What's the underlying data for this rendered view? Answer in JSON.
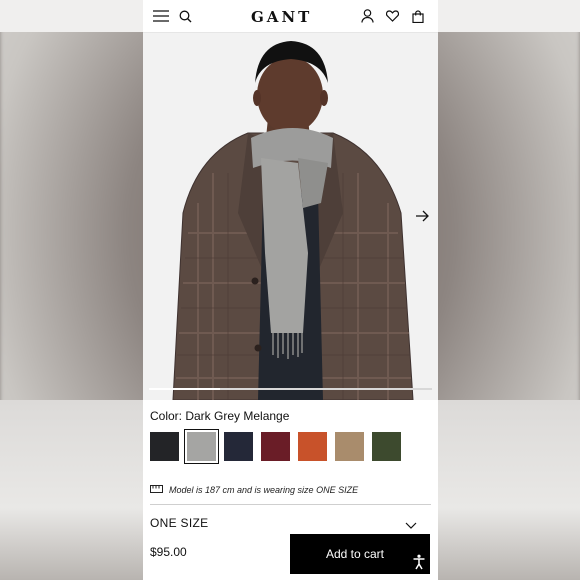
{
  "header": {
    "brand": "GANT",
    "icons": [
      "menu-icon",
      "search-icon",
      "account-icon",
      "wishlist-icon",
      "bag-icon"
    ]
  },
  "gallery": {
    "next_icon": "arrow-right-icon",
    "progress": 0.25
  },
  "product": {
    "color_label": "Color: Dark Grey Melange",
    "swatches": [
      {
        "name": "black",
        "hex": "#232427",
        "selected": false
      },
      {
        "name": "dark-grey-melange",
        "hex": "#a5a5a3",
        "selected": true
      },
      {
        "name": "navy",
        "hex": "#242838",
        "selected": false
      },
      {
        "name": "burgundy",
        "hex": "#6a1d27",
        "selected": false
      },
      {
        "name": "orange",
        "hex": "#c8522a",
        "selected": false
      },
      {
        "name": "camel",
        "hex": "#a98c6c",
        "selected": false
      },
      {
        "name": "olive",
        "hex": "#3d4a2e",
        "selected": false
      }
    ],
    "model_info": "Model is 187 cm and is wearing size ONE SIZE",
    "size": "ONE SIZE",
    "price": "$95.00",
    "add_to_cart": "Add to cart"
  },
  "colors": {
    "accent": "#000000",
    "text": "#111111"
  }
}
